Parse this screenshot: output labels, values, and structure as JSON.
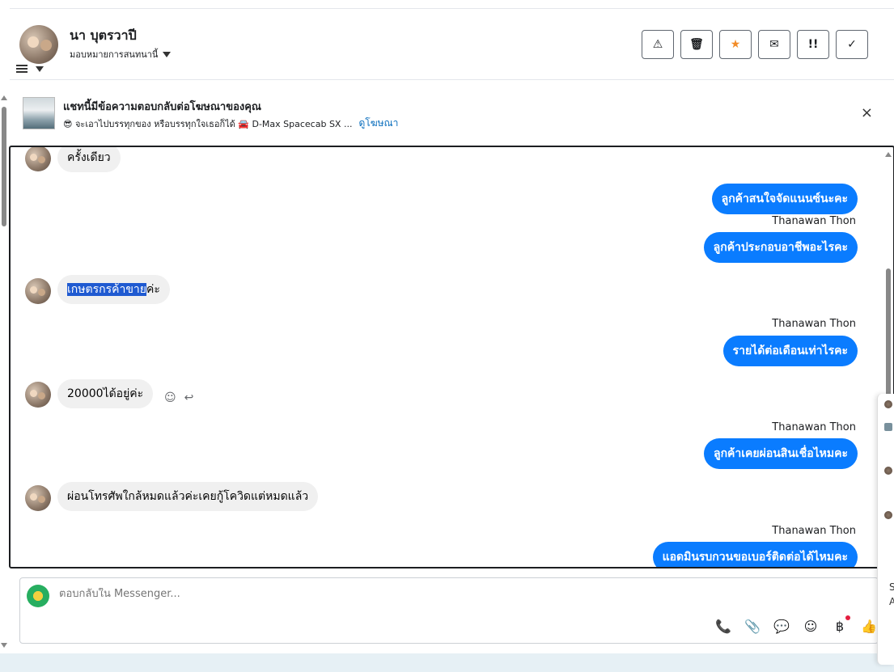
{
  "contact": {
    "name": "นา บุตรวาปี",
    "status": "มอบหมายการสนทนานี้"
  },
  "actions": [
    {
      "name": "report-button",
      "glyph": "⚠"
    },
    {
      "name": "delete-button",
      "glyph": "🗑"
    },
    {
      "name": "star-button",
      "glyph": "★"
    },
    {
      "name": "mark-unread-button",
      "glyph": "✉"
    },
    {
      "name": "spam-button",
      "glyph": "!!"
    },
    {
      "name": "done-button",
      "glyph": "✓"
    }
  ],
  "ad": {
    "title": "แชทนี้มีข้อความตอบกลับต่อโฆษณาของคุณ",
    "subtitle": "😎 จะเอาไปบรรทุกของ หรือบรรทุกใจเธอก็ได้ 🚘 D-Max Spacecab SX ...",
    "link": "ดูโฆษณา",
    "close": "×"
  },
  "messages": {
    "m1": "ครั้งเดียว",
    "m2": "ลูกค้าสนใจจัดแนนซ์นะคะ",
    "m3_sender": "Thanawan Thon",
    "m3": "ลูกค้าประกอบอาชีพอะไรคะ",
    "m4_highlight": "เกษตรกรค้าขาย",
    "m4_rest": "ค่ะ",
    "m5_sender": "Thanawan Thon",
    "m5": "รายได้ต่อเดือนเท่าไรคะ",
    "m6": "20000ได้อยู่ค่ะ",
    "m7_sender": "Thanawan Thon",
    "m7": "ลูกค้าเคยผ่อนสินเชื่อไหมคะ",
    "m8": "ผ่อนโทรศัพใกล้หมดแล้วค่ะเคยกู้โควิดแต่หมดแล้ว",
    "m9_sender": "Thanawan Thon",
    "m9": "แอดมินรบกวนขอเบอร์ติดต่อได้ไหมคะ"
  },
  "composer": {
    "placeholder": "ตอบกลับใน Messenger..."
  },
  "right_panel": {
    "letter_s": "S",
    "letter_a": "A"
  },
  "colors": {
    "outgoing_bubble": "#0a7cff",
    "incoming_bubble": "#f0f0f0",
    "star": "#f28c28",
    "link": "#0a6ebd"
  }
}
